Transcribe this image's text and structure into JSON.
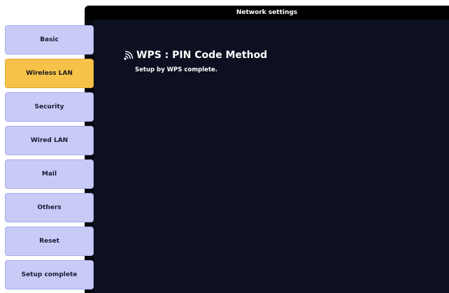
{
  "window": {
    "title": "Network settings"
  },
  "sidebar": {
    "items": [
      {
        "label": "Basic",
        "active": false
      },
      {
        "label": "Wireless LAN",
        "active": true
      },
      {
        "label": "Security",
        "active": false
      },
      {
        "label": "Wired LAN",
        "active": false
      },
      {
        "label": "Mail",
        "active": false
      },
      {
        "label": "Others",
        "active": false
      },
      {
        "label": "Reset",
        "active": false
      },
      {
        "label": "Setup complete",
        "active": false
      }
    ]
  },
  "main": {
    "icon": "wireless-signal-icon",
    "heading": "WPS : PIN Code Method",
    "status": "Setup by WPS complete."
  },
  "colors": {
    "panel_background": "#0c1020",
    "menu_item": "#c9cbf7",
    "menu_item_active": "#f7c24a",
    "titlebar": "#000000"
  }
}
